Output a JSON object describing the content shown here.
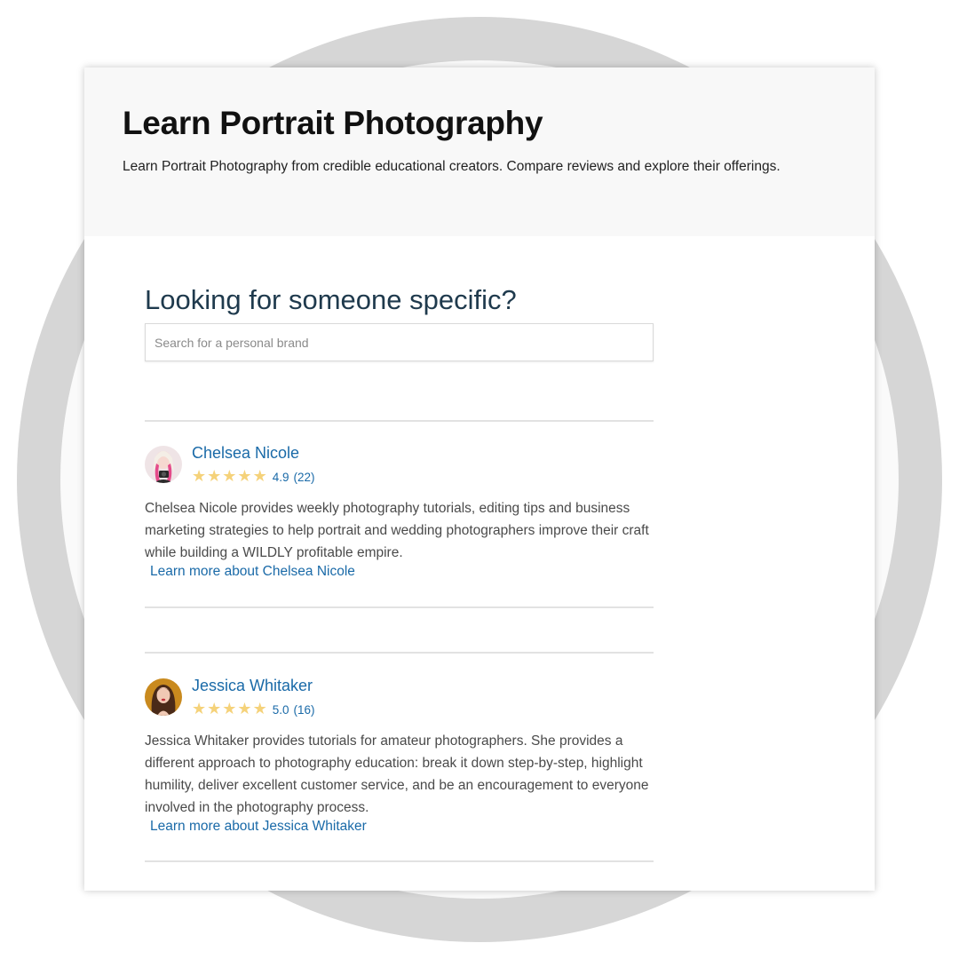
{
  "hero": {
    "title": "Learn Portrait Photography",
    "subtitle": "Learn Portrait Photography from credible educational creators. Compare reviews and explore their offerings."
  },
  "search": {
    "heading": "Looking for someone specific?",
    "placeholder": "Search for a personal brand",
    "value": ""
  },
  "creators": [
    {
      "name": "Chelsea Nicole",
      "rating": "4.9",
      "rating_fraction": 0.98,
      "review_count": "(22)",
      "description": "Chelsea Nicole provides weekly photography tutorials, editing tips and business marketing strategies to help portrait and wedding photographers improve their craft while building a WILDLY profitable empire.",
      "learn_more": "Learn more about Chelsea Nicole"
    },
    {
      "name": "Jessica Whitaker",
      "rating": "5.0",
      "rating_fraction": 1.0,
      "review_count": "(16)",
      "description": "Jessica Whitaker provides tutorials for amateur photographers. She provides a different approach to photography education: break it down step-by-step, highlight humility, deliver excellent customer service, and be an encouragement to everyone involved in the photography process.",
      "learn_more": "Learn more about Jessica Whitaker"
    }
  ],
  "colors": {
    "link": "#1a6aa8",
    "star": "#f5d27a",
    "heading": "#1f3a4d",
    "background_ring": "#d6d6d6"
  },
  "icons": {
    "star": "star-icon"
  }
}
